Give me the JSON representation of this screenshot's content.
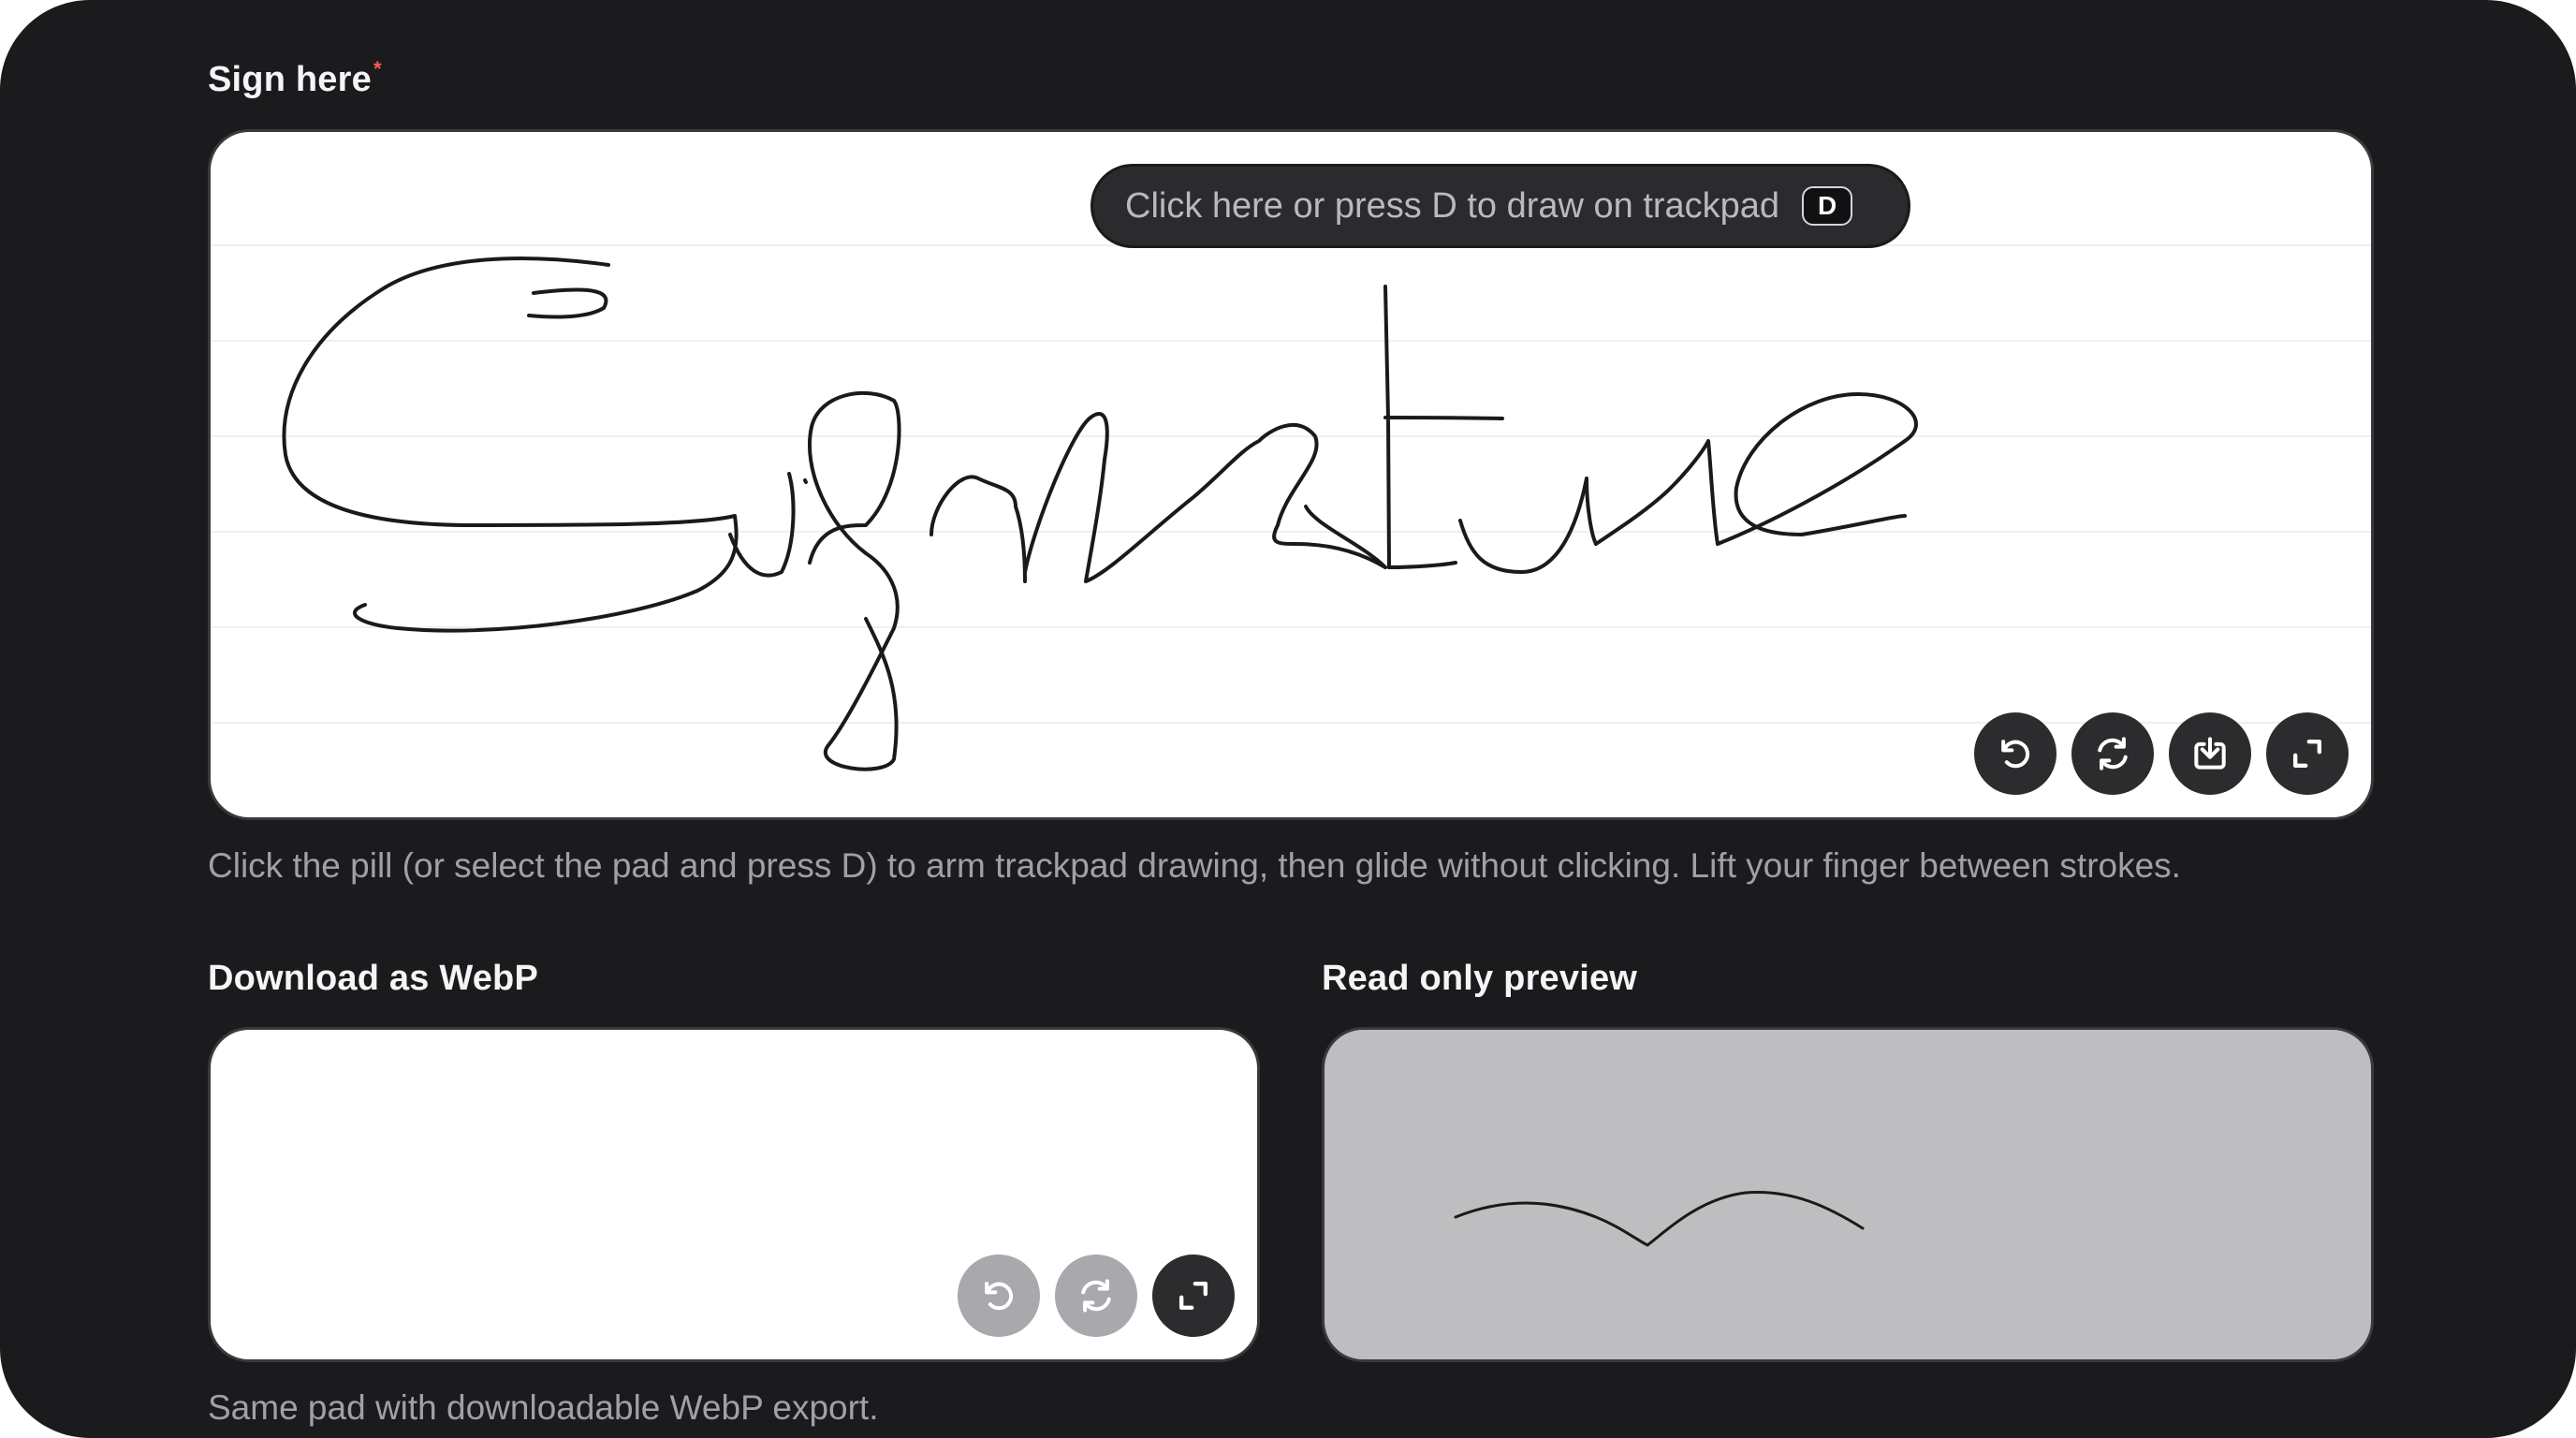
{
  "main_pad": {
    "label": "Sign here",
    "required_marker": "*",
    "pill_text": "Click here or press D to draw on trackpad",
    "pill_key": "D",
    "helper_text": "Click the pill (or select the pad and press D) to arm trackpad drawing, then glide without clicking. Lift your finger between strokes.",
    "toolbar": [
      "undo-icon",
      "clear-icon",
      "download-icon",
      "fullscreen-icon"
    ]
  },
  "webp_pad": {
    "label": "Download as WebP",
    "helper_text": "Same pad with downloadable WebP export.",
    "toolbar": [
      "undo-icon",
      "clear-icon",
      "fullscreen-icon"
    ]
  },
  "preview_pad": {
    "label": "Read only preview"
  },
  "colors": {
    "background": "#1b1b1d",
    "pad_white": "#ffffff",
    "pad_readonly": "#bebec0",
    "ink": "#1a1a1a",
    "button_dark": "#2c2c2f",
    "button_disabled": "#a9a9ad",
    "required": "#ff5a5a"
  }
}
